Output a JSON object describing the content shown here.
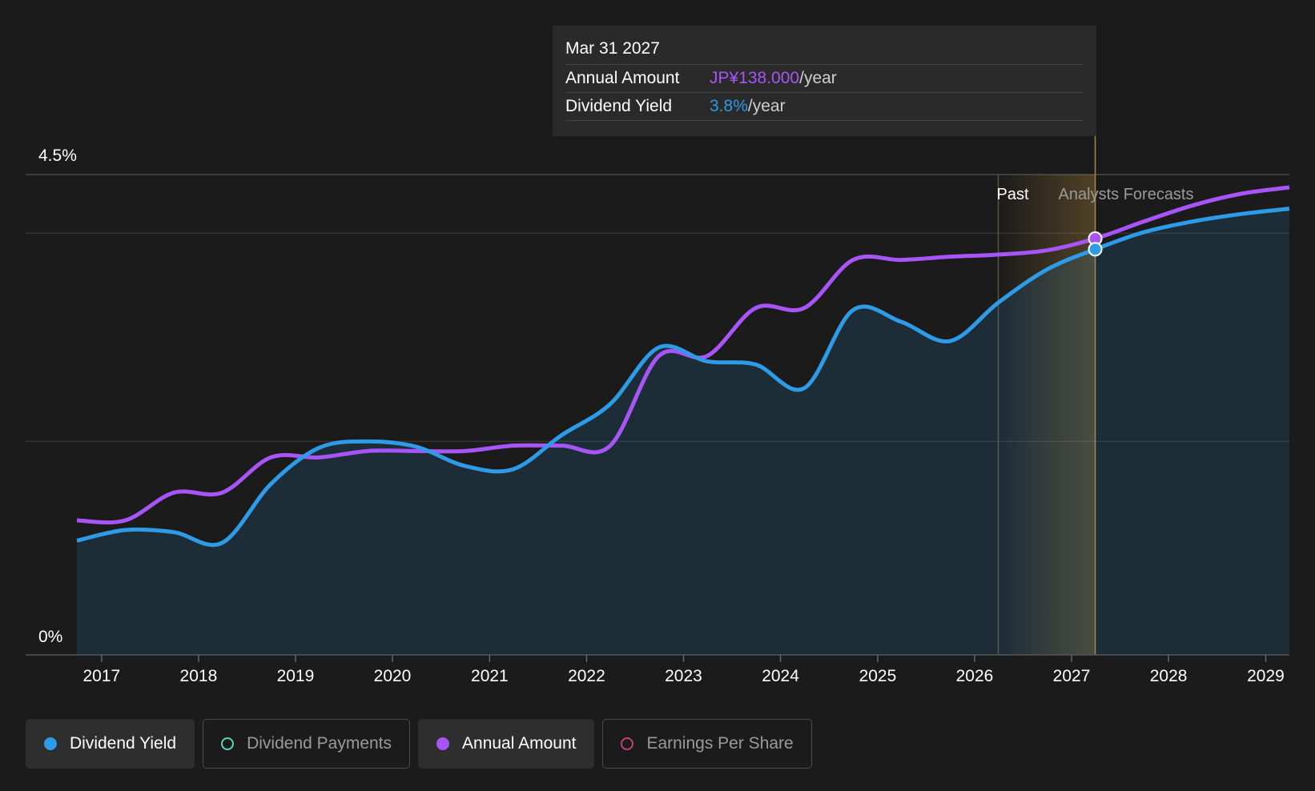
{
  "tooltip": {
    "date": "Mar 31 2027",
    "amount_label": "Annual Amount",
    "amount_value": "JP¥138.000",
    "amount_unit": "/year",
    "yield_label": "Dividend Yield",
    "yield_value": "3.8%",
    "yield_unit": "/year"
  },
  "legend": [
    {
      "label": "Dividend Yield",
      "color": "#2d9be6",
      "active": true,
      "filled": true
    },
    {
      "label": "Dividend Payments",
      "color": "#5fd3b8",
      "active": false,
      "filled": false
    },
    {
      "label": "Annual Amount",
      "color": "#a855f7",
      "active": true,
      "filled": true
    },
    {
      "label": "Earnings Per Share",
      "color": "#c2407a",
      "active": false,
      "filled": false
    }
  ],
  "colors": {
    "yield": "#2d9be6",
    "amount": "#a855f7",
    "background": "#1b1b1b",
    "forecast_band": "#d9a441"
  },
  "chart_data": {
    "type": "line",
    "x_axis": {
      "type": "date",
      "ticks": [
        "2017",
        "2018",
        "2019",
        "2020",
        "2021",
        "2022",
        "2023",
        "2024",
        "2025",
        "2026",
        "2027",
        "2028",
        "2029"
      ],
      "range": [
        "2016-09-30",
        "2029-03-31"
      ]
    },
    "y_axis": {
      "ticks_labeled": [
        "0%",
        "4.5%"
      ],
      "range": [
        0,
        4.5
      ],
      "unit": "%"
    },
    "regions": {
      "past_label": "Past",
      "forecast_label": "Analysts Forecasts",
      "boundary": "2026-03-31",
      "highlight_date": "2027-03-31"
    },
    "series": [
      {
        "name": "Dividend Yield",
        "unit": "%",
        "points": [
          [
            "2016-09-30",
            1.07
          ],
          [
            "2017-03-31",
            1.17
          ],
          [
            "2017-09-30",
            1.15
          ],
          [
            "2018-03-31",
            1.05
          ],
          [
            "2018-09-30",
            1.6
          ],
          [
            "2019-03-31",
            1.94
          ],
          [
            "2019-09-30",
            2.0
          ],
          [
            "2020-03-31",
            1.95
          ],
          [
            "2020-09-30",
            1.77
          ],
          [
            "2021-03-31",
            1.74
          ],
          [
            "2021-09-30",
            2.06
          ],
          [
            "2022-03-31",
            2.35
          ],
          [
            "2022-09-30",
            2.88
          ],
          [
            "2023-03-31",
            2.75
          ],
          [
            "2023-09-30",
            2.72
          ],
          [
            "2024-03-31",
            2.5
          ],
          [
            "2024-09-30",
            3.23
          ],
          [
            "2025-03-31",
            3.12
          ],
          [
            "2025-09-30",
            2.94
          ],
          [
            "2026-03-31",
            3.3
          ],
          [
            "2026-09-30",
            3.61
          ],
          [
            "2027-03-31",
            3.8
          ],
          [
            "2027-09-30",
            3.96
          ],
          [
            "2028-03-31",
            4.06
          ],
          [
            "2028-09-30",
            4.13
          ],
          [
            "2029-03-31",
            4.18
          ]
        ]
      },
      {
        "name": "Annual Amount",
        "unit": "%",
        "points": [
          [
            "2016-09-30",
            1.26
          ],
          [
            "2017-03-31",
            1.26
          ],
          [
            "2017-09-30",
            1.52
          ],
          [
            "2018-03-31",
            1.52
          ],
          [
            "2018-09-30",
            1.85
          ],
          [
            "2019-03-31",
            1.85
          ],
          [
            "2019-09-30",
            1.91
          ],
          [
            "2020-03-31",
            1.91
          ],
          [
            "2020-09-30",
            1.91
          ],
          [
            "2021-03-31",
            1.96
          ],
          [
            "2021-09-30",
            1.96
          ],
          [
            "2022-03-31",
            1.96
          ],
          [
            "2022-09-30",
            2.8
          ],
          [
            "2023-03-31",
            2.8
          ],
          [
            "2023-09-30",
            3.25
          ],
          [
            "2024-03-31",
            3.25
          ],
          [
            "2024-09-30",
            3.7
          ],
          [
            "2025-03-31",
            3.7
          ],
          [
            "2025-09-30",
            3.73
          ],
          [
            "2026-03-31",
            3.75
          ],
          [
            "2026-09-30",
            3.79
          ],
          [
            "2027-03-31",
            3.9
          ],
          [
            "2027-09-30",
            4.06
          ],
          [
            "2028-03-31",
            4.21
          ],
          [
            "2028-09-30",
            4.32
          ],
          [
            "2029-03-31",
            4.38
          ]
        ]
      }
    ]
  }
}
